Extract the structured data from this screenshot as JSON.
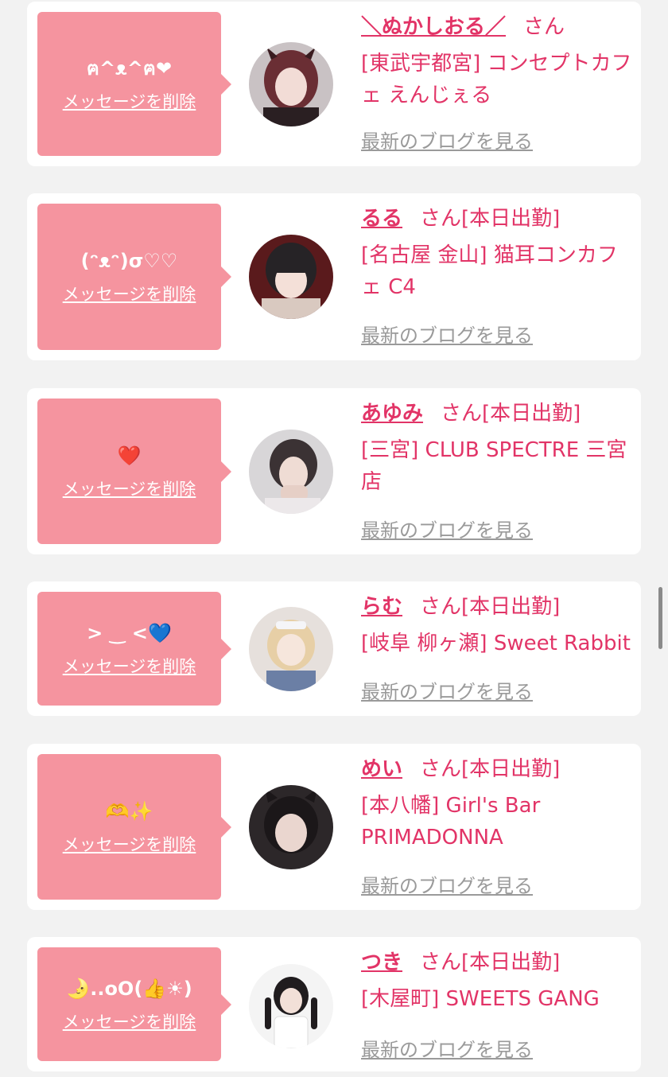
{
  "delete_label": "メッセージを削除",
  "blog_label": "最新のブログを見る",
  "san_label": "さん",
  "accent_color": "#e23467",
  "bubble_color": "#f5949f",
  "cards": [
    {
      "message": "ฅ^ᴥ^ฅ❤",
      "name": "＼ぬかしおる／",
      "status": "",
      "shop": "[東武宇都宮] コンセプトカフェ えんじぇる"
    },
    {
      "message": "(ᵔᴥᵔ)σ♡♡",
      "name": "るる",
      "status": "[本日出勤]",
      "shop": "[名古屋 金山] 猫耳コンカフェ C4"
    },
    {
      "message": "❤️",
      "name": "あゆみ",
      "status": "[本日出勤]",
      "shop": "[三宮] CLUB SPECTRE 三宮店"
    },
    {
      "message": "> ‿ <💙",
      "name": "らむ",
      "status": "[本日出勤]",
      "shop": "[岐阜 柳ヶ瀬] Sweet Rabbit"
    },
    {
      "message": "🫶✨",
      "name": "めい",
      "status": "[本日出勤]",
      "shop": "[本八幡] Girl's Bar PRIMADONNA"
    },
    {
      "message": "🌛..oO(👍☀)",
      "name": "つき",
      "status": "[本日出勤]",
      "shop": "[木屋町] SWEETS GANG"
    }
  ]
}
